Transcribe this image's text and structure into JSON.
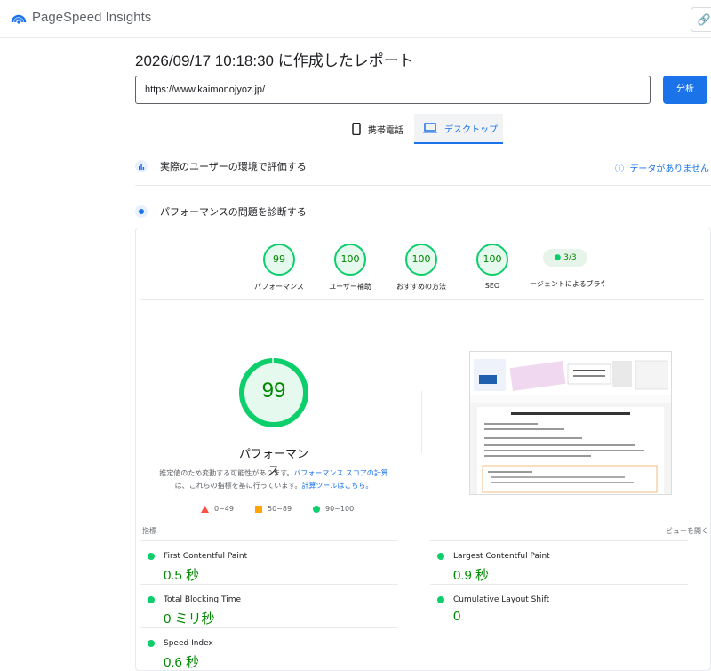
{
  "app": {
    "title": "PageSpeed Insights",
    "link_icon": "link-icon"
  },
  "report": {
    "title": "2026/09/17 10:18:30 に作成したレポート"
  },
  "search": {
    "url": "https://www.kaimonojyoz.jp/",
    "analyze_label": "分析"
  },
  "tabs": {
    "mobile": "携帯電話",
    "desktop": "デスクトップ"
  },
  "sections": {
    "field": "実際のユーザーの環境で評価する",
    "no_data": "データがありません",
    "lab": "パフォーマンスの問題を診断する"
  },
  "gauges": [
    {
      "score": "99",
      "label": "パフォーマンス"
    },
    {
      "score": "100",
      "label": "ユーザー補助"
    },
    {
      "score": "100",
      "label": "おすすめの方法"
    },
    {
      "score": "100",
      "label": "SEO"
    }
  ],
  "agent": {
    "pill": "3/3",
    "label": "ージェントによるブラウジン"
  },
  "performance": {
    "score": 99,
    "title": "パフォーマンス",
    "note_pre": "推定値のため変動する可能性があります。",
    "note_link1": "パフォーマンス スコアの計算",
    "note_mid": "は、これらの指標を基に行っています。",
    "note_link2": "計算ツールはこちら。",
    "legend": [
      "0~49",
      "50~89",
      "90~100"
    ]
  },
  "metrics_header": {
    "left": "指標",
    "right": "ビューを開く"
  },
  "metrics": [
    {
      "name": "First Contentful Paint",
      "value": "0.5 秒"
    },
    {
      "name": "Largest Contentful Paint",
      "value": "0.9 秒"
    },
    {
      "name": "Total Blocking Time",
      "value": "0 ミリ秒"
    },
    {
      "name": "Cumulative Layout Shift",
      "value": "0"
    },
    {
      "name": "Speed Index",
      "value": "0.6 秒"
    }
  ],
  "colors": {
    "good": "#0cce6b",
    "good_text": "#008800",
    "average": "#ffa400",
    "poor": "#ff4e42",
    "accent": "#1a73e8"
  }
}
